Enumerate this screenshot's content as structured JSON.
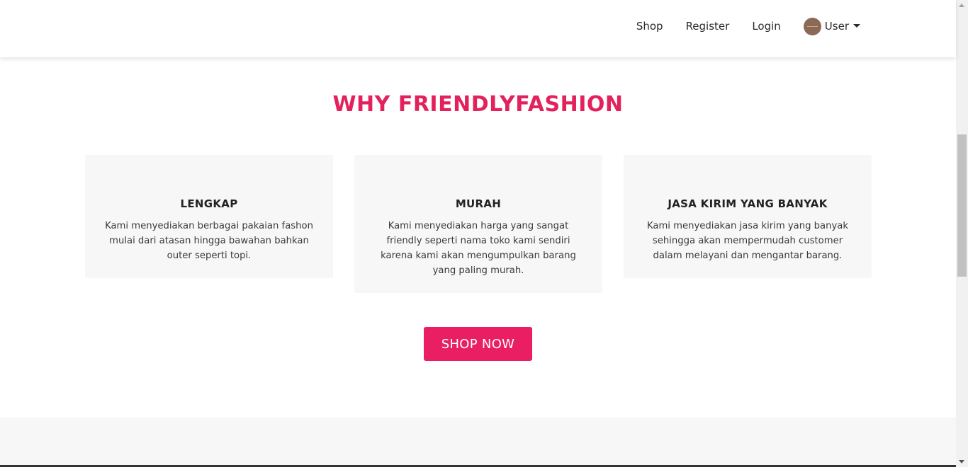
{
  "nav": {
    "links": [
      "Shop",
      "Register",
      "Login"
    ],
    "user_label": "User",
    "user_avatar_icon": "user-avatar-icon",
    "dropdown_icon": "caret-down-icon"
  },
  "section": {
    "title": "WHY FRIENDLYFASHION",
    "cards": [
      {
        "title": "LENGKAP",
        "text": "Kami menyediakan berbagai pakaian fashon mulai dari atasan hingga bawahan bahkan outer seperti topi."
      },
      {
        "title": "MURAH",
        "text": "Kami menyediakan harga yang sangat friendly seperti nama toko kami sendiri karena kami akan mengumpulkan barang yang paling murah."
      },
      {
        "title": "JASA KIRIM YANG BANYAK",
        "text": "Kami menyediakan jasa kirim yang banyak sehingga akan mempermudah customer dalam melayani dan mengantar barang."
      }
    ],
    "cta_label": "SHOP NOW"
  },
  "colors": {
    "accent": "#e91e63",
    "title": "#e3215d",
    "card_bg": "#f7f7f7"
  }
}
